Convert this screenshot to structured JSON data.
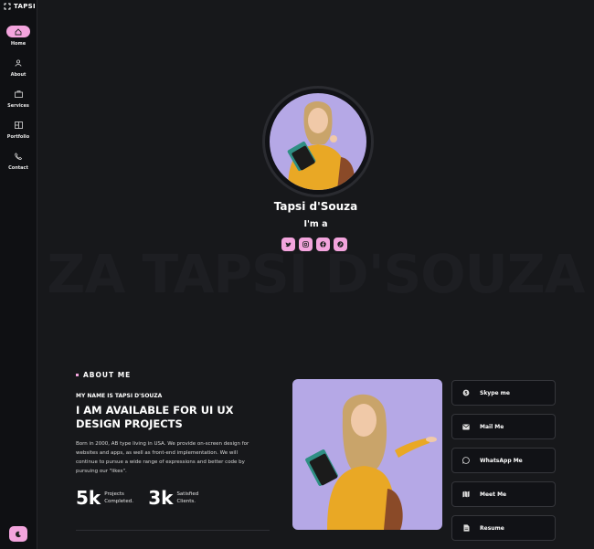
{
  "brand": {
    "name": "TAPSI"
  },
  "nav": [
    {
      "label": "Home",
      "icon": "home-icon",
      "active": true
    },
    {
      "label": "About",
      "icon": "user-icon",
      "active": false
    },
    {
      "label": "Services",
      "icon": "briefcase-icon",
      "active": false
    },
    {
      "label": "Portfolio",
      "icon": "portfolio-icon",
      "active": false
    },
    {
      "label": "Contact",
      "icon": "phone-icon",
      "active": false
    }
  ],
  "hero": {
    "name": "Tapsi d'Souza",
    "intro": "I'm a",
    "background_text": "ZA TAPSI D'SOUZA",
    "socials": [
      "twitter-icon",
      "instagram-icon",
      "facebook-icon",
      "pinterest-icon"
    ]
  },
  "about": {
    "section_label": "ABOUT ME",
    "my_name": "MY NAME IS TAPSI D'SOUZA",
    "headline": "I AM AVAILABLE FOR UI UX DESIGN PROJECTS",
    "bio": "Born in 2000, AB type living in USA. We provide on-screen design for websites and apps, as well as front-end implementation. We will continue to pursue a wide range of expressions and better code by pursuing our \"likes\".",
    "stats": [
      {
        "value": "5k",
        "label": "Projects Completed."
      },
      {
        "value": "3k",
        "label": "Satisfied Clients."
      }
    ]
  },
  "contacts": [
    {
      "label": "Skype me",
      "icon": "skype-icon"
    },
    {
      "label": "Mail Me",
      "icon": "mail-icon"
    },
    {
      "label": "WhatsApp Me",
      "icon": "whatsapp-icon"
    },
    {
      "label": "Meet Me",
      "icon": "map-icon"
    },
    {
      "label": "Resume",
      "icon": "document-icon"
    }
  ],
  "colors": {
    "accent": "#f3a4dd",
    "background": "#17181b",
    "sidebar": "#0f1013"
  }
}
